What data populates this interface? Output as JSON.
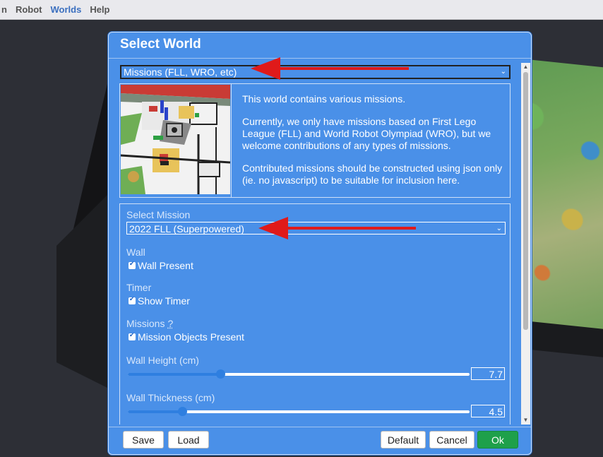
{
  "menubar": {
    "items": [
      "n",
      "Robot",
      "Worlds",
      "Help"
    ],
    "active_index": 2
  },
  "dialog": {
    "title": "Select World",
    "world_select": {
      "value": "Missions (FLL, WRO, etc)"
    },
    "description": [
      "This world contains various missions.",
      "Currently, we only have missions based on First Lego League (FLL) and World Robot Olympiad (WRO), but we welcome contributions of any types of missions.",
      "Contributed missions should be constructed using json only (ie. no javascript) to be suitable for inclusion here."
    ],
    "mission": {
      "label": "Select Mission",
      "value": "2022 FLL (Superpowered)"
    },
    "wall": {
      "label": "Wall",
      "checkbox_label": "Wall Present",
      "checked": true
    },
    "timer": {
      "label": "Timer",
      "checkbox_label": "Show Timer",
      "checked": true
    },
    "missions": {
      "label": "Missions",
      "help": "?",
      "checkbox_label": "Mission Objects Present",
      "checked": true
    },
    "wall_height": {
      "label": "Wall Height (cm)",
      "value": "7.7",
      "fraction": 0.27
    },
    "wall_thickness": {
      "label": "Wall Thickness (cm)",
      "value": "4.5",
      "fraction": 0.16
    },
    "buttons": {
      "save": "Save",
      "load": "Load",
      "default": "Default",
      "cancel": "Cancel",
      "ok": "Ok"
    }
  },
  "colors": {
    "dialog_bg": "#4a90e8",
    "ok_button": "#1ea04a",
    "annotation_arrow": "#e01a1a",
    "active_menu": "#3b6fbf"
  }
}
